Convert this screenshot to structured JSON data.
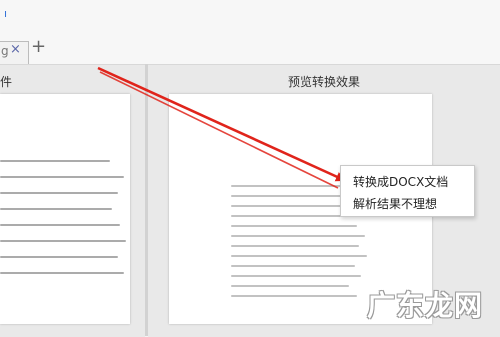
{
  "app": {
    "tab_label": "g",
    "tab_close_glyph": "×",
    "new_tab_glyph": "+"
  },
  "left_pane": {
    "title": "件"
  },
  "right_pane": {
    "title": "预览转换效果"
  },
  "context_menu": {
    "items": [
      "转换成DOCX文档",
      "解析结果不理想"
    ]
  },
  "annotation": {
    "arrow_color": "#e0241b"
  },
  "watermark": {
    "text": "广东龙网"
  },
  "colors": {
    "accent": "#2f6fd6",
    "pane_bg": "#e9e9e9"
  }
}
